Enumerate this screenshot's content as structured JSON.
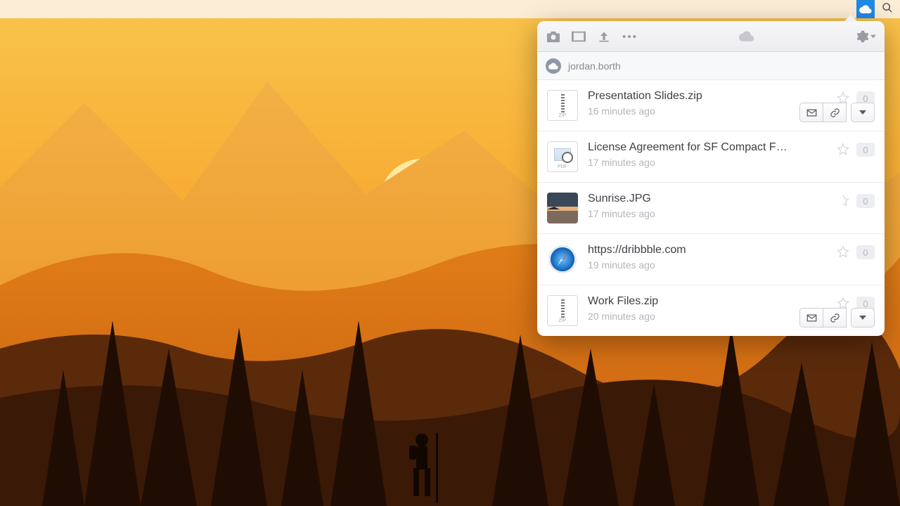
{
  "menubar": {
    "cloud_icon": "cloud-icon",
    "search_icon": "search-icon"
  },
  "popover": {
    "toolbar": {
      "camera": "camera-icon",
      "video": "video-icon",
      "upload": "upload-icon",
      "more": "more-icon",
      "cloud": "cloud-icon",
      "gear": "gear-icon"
    },
    "user": {
      "name": "jordan.borth"
    },
    "items": [
      {
        "title": "Presentation Slides.zip",
        "time": "16 minutes ago",
        "views": "0",
        "thumb": "zip",
        "show_actions": true
      },
      {
        "title": "License Agreement for SF Compact F…",
        "time": "17 minutes ago",
        "views": "0",
        "thumb": "pdf",
        "show_actions": false
      },
      {
        "title": "Sunrise.JPG",
        "time": "17 minutes ago",
        "views": "0",
        "thumb": "img",
        "show_actions": false
      },
      {
        "title": "https://dribbble.com",
        "time": "19 minutes ago",
        "views": "0",
        "thumb": "safari",
        "show_actions": false
      },
      {
        "title": "Work Files.zip",
        "time": "20 minutes ago",
        "views": "0",
        "thumb": "zip",
        "show_actions": true
      }
    ]
  }
}
